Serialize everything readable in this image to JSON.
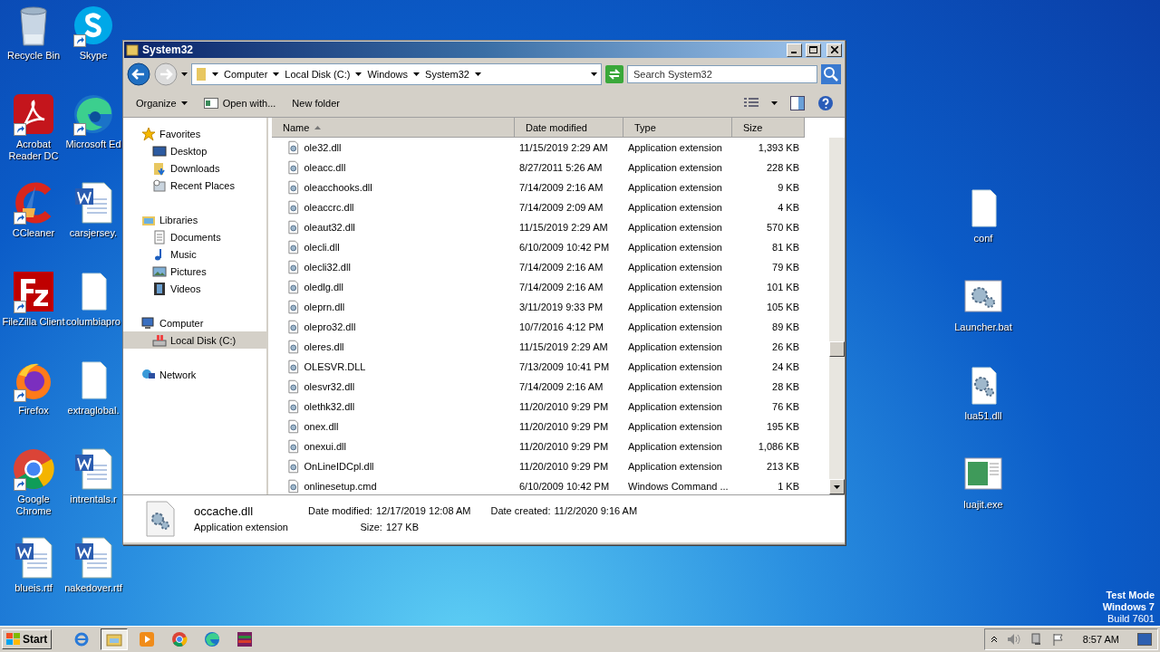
{
  "desktop": {
    "icons_left": [
      {
        "label": "Recycle Bin",
        "kind": "bin",
        "shortcut": false
      },
      {
        "label": "Acrobat Reader DC",
        "kind": "pdf",
        "shortcut": true
      },
      {
        "label": "CCleaner",
        "kind": "ccleaner",
        "shortcut": true
      },
      {
        "label": "FileZilla Client",
        "kind": "filezilla",
        "shortcut": true
      },
      {
        "label": "Firefox",
        "kind": "firefox",
        "shortcut": true
      },
      {
        "label": "Google Chrome",
        "kind": "chrome",
        "shortcut": true
      },
      {
        "label": "blueis.rtf",
        "kind": "word",
        "shortcut": false
      }
    ],
    "icons_second": [
      {
        "label": "Skype",
        "kind": "skype",
        "shortcut": true
      },
      {
        "label": "Microsoft Ed",
        "kind": "edge",
        "shortcut": true
      },
      {
        "label": "carsjersey.",
        "kind": "word",
        "shortcut": false
      },
      {
        "label": "columbiapro",
        "kind": "none",
        "shortcut": false
      },
      {
        "label": "extraglobal.",
        "kind": "none",
        "shortcut": false
      },
      {
        "label": "intrentals.r",
        "kind": "word",
        "shortcut": false
      },
      {
        "label": "nakedover.rtf",
        "kind": "word",
        "shortcut": false
      }
    ],
    "icons_right": [
      {
        "label": "conf",
        "kind": "blank"
      },
      {
        "label": "Launcher.bat",
        "kind": "gears"
      },
      {
        "label": "lua51.dll",
        "kind": "gearsdoc"
      },
      {
        "label": "luajit.exe",
        "kind": "exe"
      }
    ],
    "edition": {
      "line1": "Test Mode",
      "line2": "Windows 7",
      "line3": "Build 7601"
    }
  },
  "window": {
    "title": "System32",
    "breadcrumb": [
      "Computer",
      "Local Disk (C:)",
      "Windows",
      "System32"
    ],
    "search": {
      "placeholder": "Search System32"
    },
    "toolbar": {
      "organize": "Organize",
      "open_with": "Open with...",
      "new_folder": "New folder"
    },
    "nav": [
      {
        "label": "Favorites",
        "kind": "star",
        "selected": false,
        "children": [
          {
            "label": "Desktop",
            "kind": "desktop",
            "selected": false
          },
          {
            "label": "Downloads",
            "kind": "downloads",
            "selected": false
          },
          {
            "label": "Recent Places",
            "kind": "recent",
            "selected": false
          }
        ]
      },
      {
        "label": "Libraries",
        "kind": "libraries",
        "selected": false,
        "children": [
          {
            "label": "Documents",
            "kind": "documents",
            "selected": false
          },
          {
            "label": "Music",
            "kind": "music",
            "selected": false
          },
          {
            "label": "Pictures",
            "kind": "pictures",
            "selected": false
          },
          {
            "label": "Videos",
            "kind": "videos",
            "selected": false
          }
        ]
      },
      {
        "label": "Computer",
        "kind": "computer",
        "selected": false,
        "children": [
          {
            "label": "Local Disk (C:)",
            "kind": "disk",
            "selected": true
          }
        ]
      },
      {
        "label": "Network",
        "kind": "network",
        "selected": false
      }
    ],
    "columns": [
      {
        "label": "Name",
        "sorted": true
      },
      {
        "label": "Date modified",
        "sorted": false
      },
      {
        "label": "Type",
        "sorted": false
      },
      {
        "label": "Size",
        "sorted": false
      }
    ],
    "files": [
      {
        "name": "ole32.dll",
        "date": "11/15/2019 2:29 AM",
        "type": "Application extension",
        "size": "1,393 KB"
      },
      {
        "name": "oleacc.dll",
        "date": "8/27/2011 5:26 AM",
        "type": "Application extension",
        "size": "228 KB"
      },
      {
        "name": "oleacchooks.dll",
        "date": "7/14/2009 2:16 AM",
        "type": "Application extension",
        "size": "9 KB"
      },
      {
        "name": "oleaccrc.dll",
        "date": "7/14/2009 2:09 AM",
        "type": "Application extension",
        "size": "4 KB"
      },
      {
        "name": "oleaut32.dll",
        "date": "11/15/2019 2:29 AM",
        "type": "Application extension",
        "size": "570 KB"
      },
      {
        "name": "olecli.dll",
        "date": "6/10/2009 10:42 PM",
        "type": "Application extension",
        "size": "81 KB"
      },
      {
        "name": "olecli32.dll",
        "date": "7/14/2009 2:16 AM",
        "type": "Application extension",
        "size": "79 KB"
      },
      {
        "name": "oledlg.dll",
        "date": "7/14/2009 2:16 AM",
        "type": "Application extension",
        "size": "101 KB"
      },
      {
        "name": "oleprn.dll",
        "date": "3/11/2019 9:33 PM",
        "type": "Application extension",
        "size": "105 KB"
      },
      {
        "name": "olepro32.dll",
        "date": "10/7/2016 4:12 PM",
        "type": "Application extension",
        "size": "89 KB"
      },
      {
        "name": "oleres.dll",
        "date": "11/15/2019 2:29 AM",
        "type": "Application extension",
        "size": "26 KB"
      },
      {
        "name": "OLESVR.DLL",
        "date": "7/13/2009 10:41 PM",
        "type": "Application extension",
        "size": "24 KB"
      },
      {
        "name": "olesvr32.dll",
        "date": "7/14/2009 2:16 AM",
        "type": "Application extension",
        "size": "28 KB"
      },
      {
        "name": "olethk32.dll",
        "date": "11/20/2010 9:29 PM",
        "type": "Application extension",
        "size": "76 KB"
      },
      {
        "name": "onex.dll",
        "date": "11/20/2010 9:29 PM",
        "type": "Application extension",
        "size": "195 KB"
      },
      {
        "name": "onexui.dll",
        "date": "11/20/2010 9:29 PM",
        "type": "Application extension",
        "size": "1,086 KB"
      },
      {
        "name": "OnLineIDCpl.dll",
        "date": "11/20/2010 9:29 PM",
        "type": "Application extension",
        "size": "213 KB"
      },
      {
        "name": "onlinesetup.cmd",
        "date": "6/10/2009 10:42 PM",
        "type": "Windows Command ...",
        "size": "1 KB"
      }
    ],
    "details": {
      "name": "occache.dll",
      "type": "Application extension",
      "modified_label": "Date modified:",
      "modified": "12/17/2019 12:08 AM",
      "created_label": "Date created:",
      "created": "11/2/2020 9:16 AM",
      "size_label": "Size:",
      "size": "127 KB"
    }
  },
  "taskbar": {
    "start": "Start",
    "apps": [
      {
        "kind": "ie",
        "selected": false
      },
      {
        "kind": "explorer",
        "selected": true
      },
      {
        "kind": "media",
        "selected": false
      },
      {
        "kind": "chrome",
        "selected": false
      },
      {
        "kind": "edge",
        "selected": false
      },
      {
        "kind": "winrar",
        "selected": false
      }
    ],
    "clock": "8:57 AM"
  }
}
